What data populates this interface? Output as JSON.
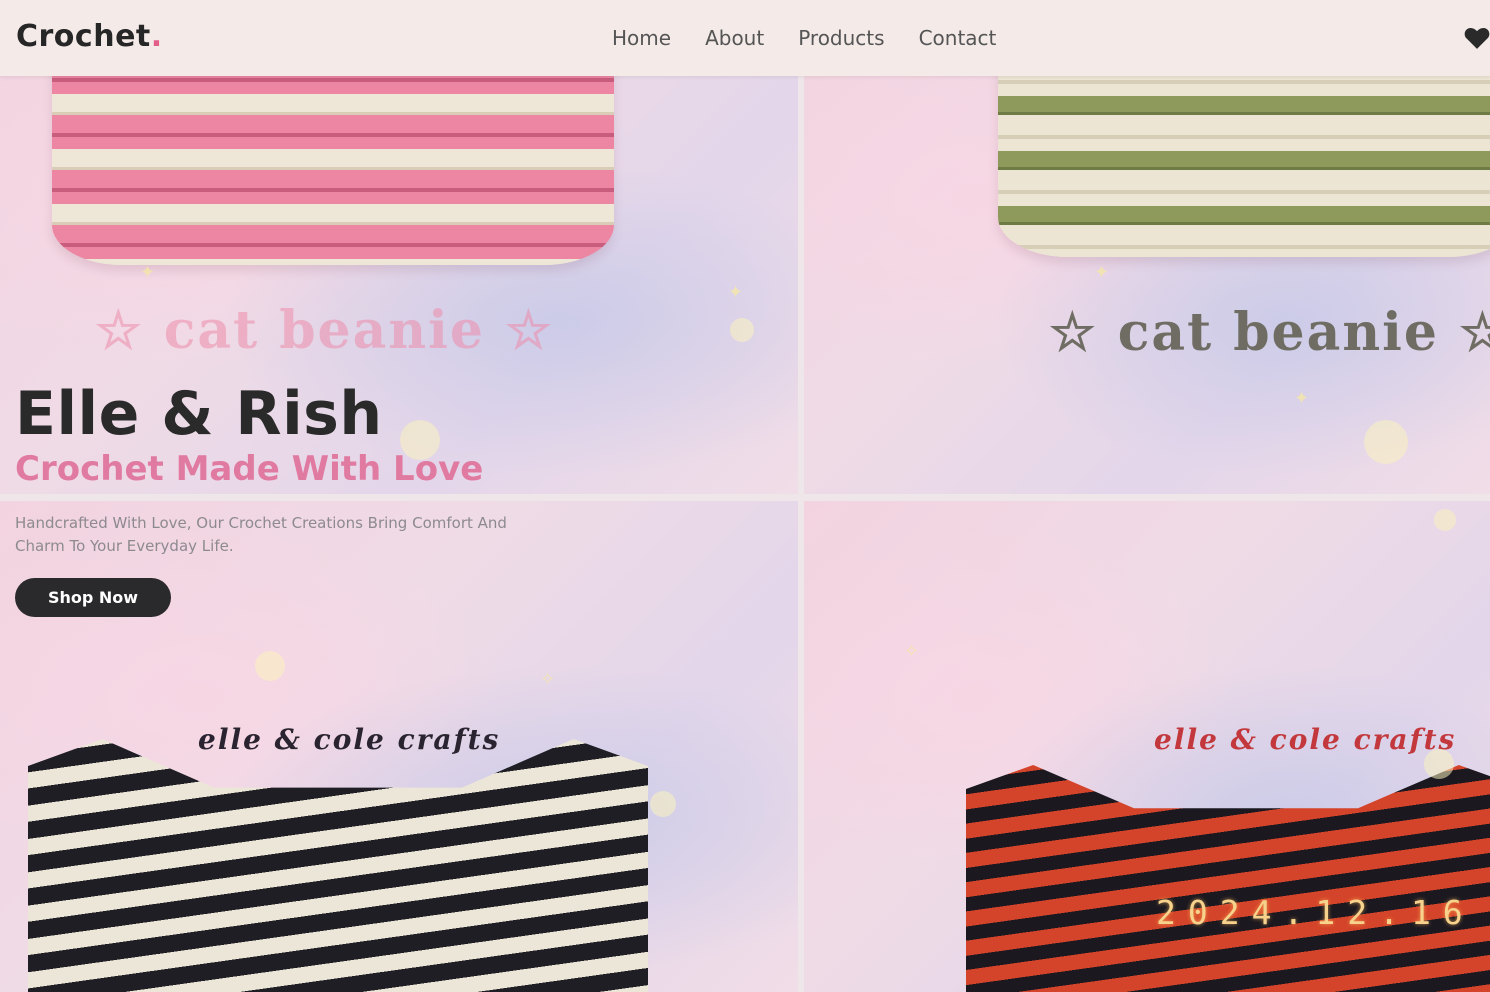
{
  "brand": {
    "name": "Crochet",
    "dot": ".",
    "accent": "#e25f8a"
  },
  "nav": {
    "items": [
      {
        "label": "Home"
      },
      {
        "label": "About"
      },
      {
        "label": "Products"
      },
      {
        "label": "Contact"
      }
    ],
    "icon": "heart-icon"
  },
  "hero": {
    "title": "Elle & Rish",
    "subtitle": "Crochet Made With Love",
    "description": "Handcrafted With Love, Our Crochet Creations Bring Comfort And Charm To Your Everyday Life.",
    "cta_label": "Shop Now"
  },
  "collage": {
    "panels": [
      {
        "caption": "☆ cat beanie ☆"
      },
      {
        "caption": "☆ cat beanie ☆"
      },
      {
        "caption": "elle & cole crafts"
      },
      {
        "caption": "elle & cole crafts",
        "datestamp": "2024.12.16"
      }
    ]
  },
  "colors": {
    "title": "#2a2a2a",
    "subtitle": "#e07aa0",
    "button": "#2a2a2c",
    "navbar": "#f4ebe9"
  }
}
